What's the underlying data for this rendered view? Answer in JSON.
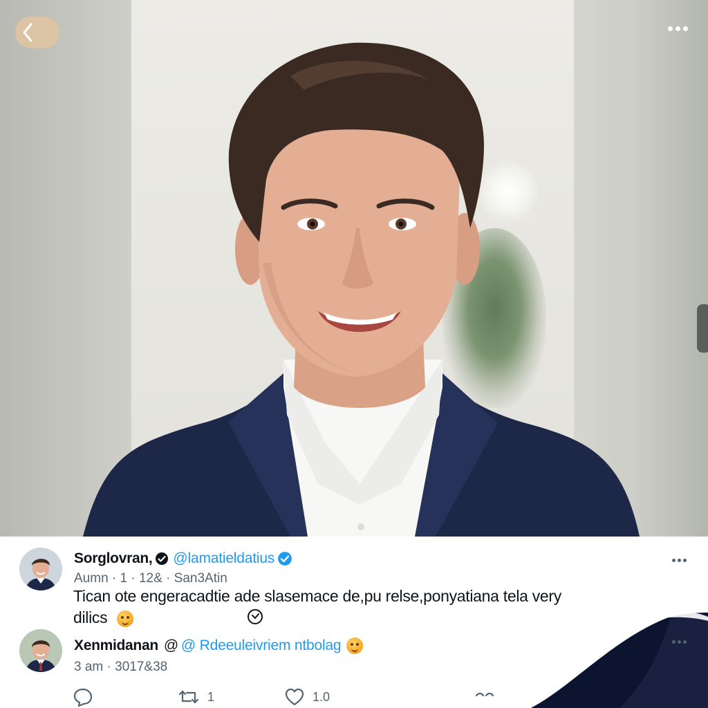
{
  "post_1": {
    "name": "Sorglovran,",
    "handle": "@lamatieldatius",
    "meta": "Aumn · 1 · 12& · San3Atin",
    "text_line_1": "Tican ote engeracadtie ade slasemace de,pu relse,ponyatiana tela very",
    "text_line_2": "dilics"
  },
  "post_2": {
    "name": "Xenmidanan",
    "at_sign": "@",
    "handle": "@ Rdeeuleivriem ntbolag",
    "meta": "3 am · 3017&38"
  },
  "actions": {
    "retweet_count": "1",
    "like_count": "1.0"
  },
  "icons": {
    "back": "chevron-left-icon",
    "more": "more-horizontal-icon",
    "verified": "verified-badge-icon",
    "reply": "reply-icon",
    "retweet": "retweet-icon",
    "like": "heart-icon",
    "share": "share-icon",
    "emoji": "smiley-emoji-icon"
  },
  "colors": {
    "accent": "#1d9bf0",
    "text": "#0f1419",
    "secondary": "#536471"
  }
}
